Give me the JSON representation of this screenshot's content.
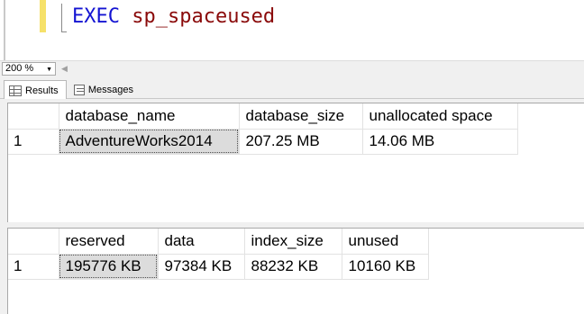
{
  "editor": {
    "keyword": "EXEC",
    "procedure": "sp_spaceused"
  },
  "zoom": {
    "value": "200 %"
  },
  "tabs": [
    {
      "label": "Results",
      "active": true,
      "icon": "grid-icon"
    },
    {
      "label": "Messages",
      "active": false,
      "icon": "messages-icon"
    }
  ],
  "result1": {
    "columns": [
      "database_name",
      "database_size",
      "unallocated space"
    ],
    "rows": [
      {
        "row_number": "1",
        "cells": [
          "AdventureWorks2014",
          "207.25 MB",
          "14.06 MB"
        ]
      }
    ]
  },
  "result2": {
    "columns": [
      "reserved",
      "data",
      "index_size",
      "unused"
    ],
    "rows": [
      {
        "row_number": "1",
        "cells": [
          "195776 KB",
          "97384 KB",
          "88232 KB",
          "10160 KB"
        ]
      }
    ]
  },
  "colors": {
    "keyword": "#1414d2",
    "procedure": "#8a0a0a",
    "change_bar": "#f6e16a",
    "selected_cell": "#dcdcdc"
  }
}
